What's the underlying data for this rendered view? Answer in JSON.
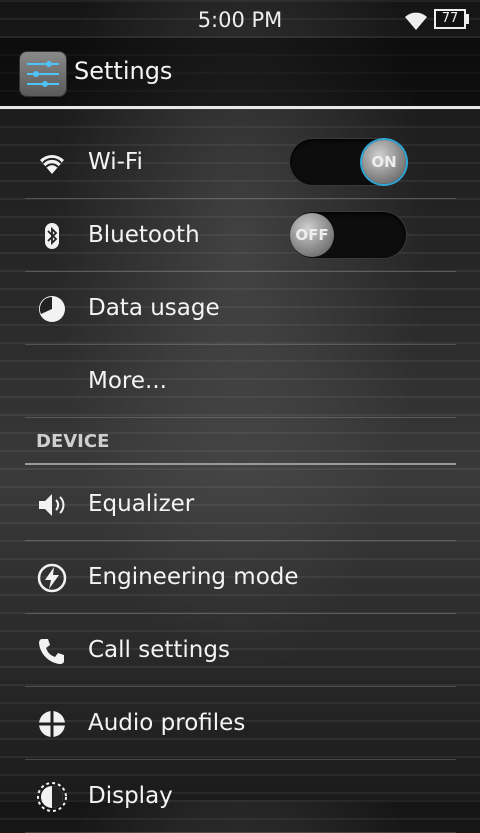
{
  "status": {
    "time": "5:00 PM",
    "battery": "77"
  },
  "app": {
    "title": "Settings",
    "icon": "settings-sliders-icon"
  },
  "wireless": [
    {
      "id": "wifi",
      "label": "Wi-Fi",
      "icon": "wifi-icon",
      "toggle": "ON"
    },
    {
      "id": "bluetooth",
      "label": "Bluetooth",
      "icon": "bluetooth-icon",
      "toggle": "OFF"
    },
    {
      "id": "data-usage",
      "label": "Data usage",
      "icon": "data-usage-icon"
    },
    {
      "id": "more",
      "label": "More..."
    }
  ],
  "device_header": "DEVICE",
  "device": [
    {
      "id": "equalizer",
      "label": "Equalizer",
      "icon": "speaker-icon"
    },
    {
      "id": "engineering-mode",
      "label": "Engineering mode",
      "icon": "lightning-icon"
    },
    {
      "id": "call-settings",
      "label": "Call settings",
      "icon": "phone-icon"
    },
    {
      "id": "audio-profiles",
      "label": "Audio profiles",
      "icon": "audio-profiles-icon"
    },
    {
      "id": "display",
      "label": "Display",
      "icon": "display-icon"
    }
  ],
  "colors": {
    "accent": "#2fa7d6",
    "text": "#f4f4f4"
  }
}
